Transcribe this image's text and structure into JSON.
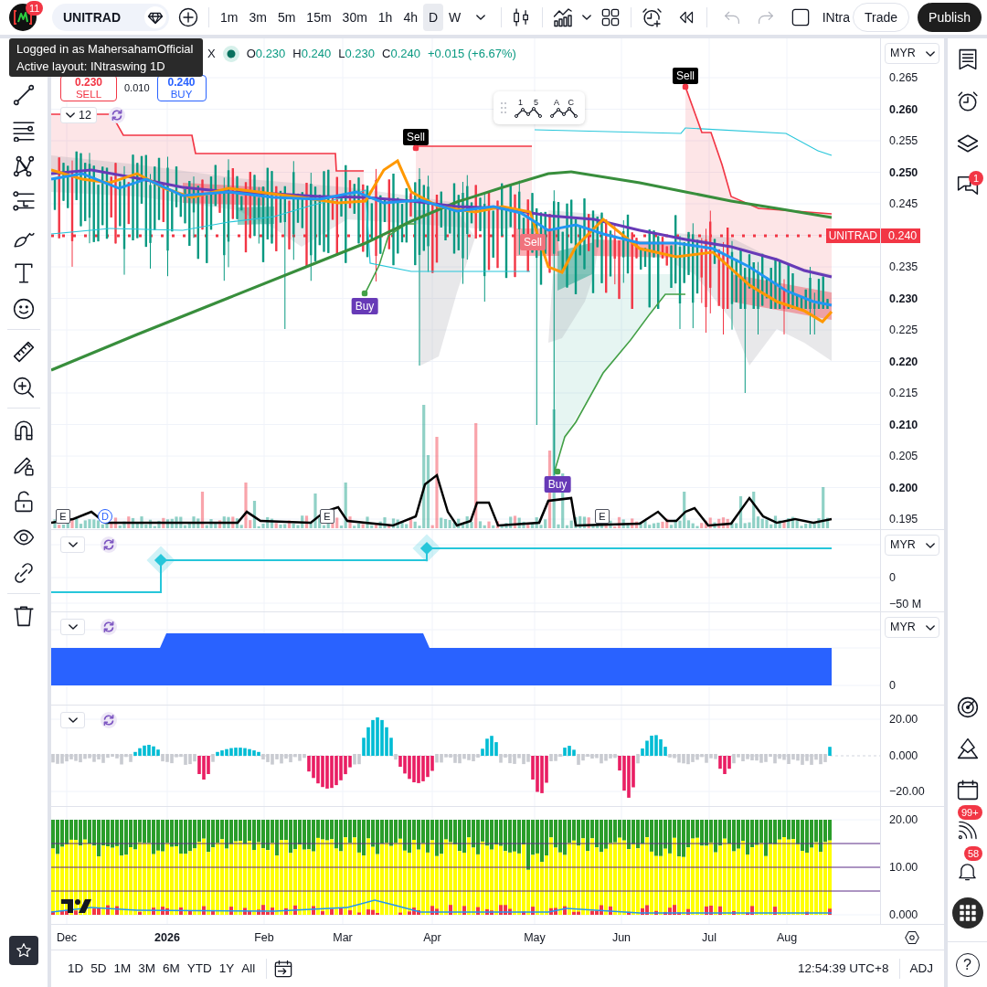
{
  "top_bar": {
    "logo_badge": "11",
    "symbol": "UNITRAD",
    "intervals": [
      {
        "label": "1m",
        "selected": false
      },
      {
        "label": "3m",
        "selected": false
      },
      {
        "label": "5m",
        "selected": false
      },
      {
        "label": "15m",
        "selected": false
      },
      {
        "label": "30m",
        "selected": false
      },
      {
        "label": "1h",
        "selected": false
      },
      {
        "label": "4h",
        "selected": false
      },
      {
        "label": "D",
        "selected": true
      },
      {
        "label": "W",
        "selected": false
      }
    ],
    "history": [
      {
        "kind": "undo",
        "disabled": true
      },
      {
        "kind": "redo",
        "disabled": true
      }
    ],
    "layout_name": "INtra",
    "buttons": [
      {
        "label": "Trade",
        "kind": "outline"
      },
      {
        "label": "Publish",
        "kind": "primary"
      }
    ]
  },
  "tooltip": {
    "lines": [
      "Logged in as MahersahamOfficial",
      "Active layout: INtraswing 1D"
    ]
  },
  "legend": {
    "symbol_tail": "X",
    "ohlc": [
      {
        "key": "O",
        "value": "0.230"
      },
      {
        "key": "H",
        "value": "0.240"
      },
      {
        "key": "L",
        "value": "0.230"
      },
      {
        "key": "C",
        "value": "0.240"
      }
    ],
    "change": "+0.015 (+6.67%)"
  },
  "order_panel": {
    "sell_price": "0.230",
    "sell_label": "SELL",
    "spread": "0.010",
    "buy_price": "0.240",
    "buy_label": "BUY"
  },
  "indicator_toggle": {
    "count": "12"
  },
  "wave_tools": [
    {
      "labels": [
        "1",
        "5"
      ]
    },
    {
      "labels": [
        "A",
        "C"
      ]
    }
  ],
  "main_pane": {
    "currency": "MYR",
    "price_ticks": [
      {
        "label": "0.265",
        "major": false
      },
      {
        "label": "0.260",
        "major": true
      },
      {
        "label": "0.255",
        "major": false
      },
      {
        "label": "0.250",
        "major": true
      },
      {
        "label": "0.245",
        "major": false
      },
      {
        "label": "0.235",
        "major": false
      },
      {
        "label": "0.230",
        "major": true
      },
      {
        "label": "0.225",
        "major": false
      },
      {
        "label": "0.220",
        "major": true
      },
      {
        "label": "0.215",
        "major": false
      },
      {
        "label": "0.210",
        "major": true
      },
      {
        "label": "0.205",
        "major": false
      },
      {
        "label": "0.200",
        "major": true
      },
      {
        "label": "0.195",
        "major": false
      }
    ],
    "last_price": {
      "symbol": "UNITRAD",
      "price": "0.240"
    },
    "signals": [
      {
        "kind": "sell",
        "label": "Sell"
      },
      {
        "kind": "sell",
        "label": "Sell"
      },
      {
        "kind": "buy",
        "label": "Buy"
      },
      {
        "kind": "buy",
        "label": "Buy"
      },
      {
        "kind": "faded_sell",
        "label": "Sell"
      }
    ],
    "events": [
      {
        "kind": "earnings",
        "label": "E"
      },
      {
        "kind": "dividend",
        "label": "D"
      },
      {
        "kind": "earnings",
        "label": "E"
      },
      {
        "kind": "earnings",
        "label": "E"
      }
    ]
  },
  "panes": [
    {
      "currency": "MYR",
      "ticks": [
        "0",
        "−50 M"
      ]
    },
    {
      "currency": "MYR",
      "ticks": [
        "0"
      ]
    },
    {
      "ticks": [
        "20.00",
        "0.000",
        "−20.00"
      ]
    },
    {
      "ticks": [
        "20.00",
        "10.00",
        "0.000"
      ]
    }
  ],
  "time_axis": {
    "labels": [
      {
        "label": "Dec",
        "major": false
      },
      {
        "label": "2026",
        "major": true
      },
      {
        "label": "Feb",
        "major": false
      },
      {
        "label": "Mar",
        "major": false
      },
      {
        "label": "Apr",
        "major": false
      },
      {
        "label": "May",
        "major": false
      },
      {
        "label": "Jun",
        "major": false
      },
      {
        "label": "Jul",
        "major": false
      },
      {
        "label": "Aug",
        "major": false
      }
    ]
  },
  "bottom_bar": {
    "ranges": [
      "1D",
      "5D",
      "1M",
      "3M",
      "6M",
      "YTD",
      "1Y",
      "All"
    ],
    "clock": "12:54:39 UTC+8",
    "adjustment": "ADJ"
  },
  "right_sidebar": {
    "chat_badge": "1",
    "feed_badge": "99+",
    "alerts_badge": "58",
    "help": "?"
  }
}
